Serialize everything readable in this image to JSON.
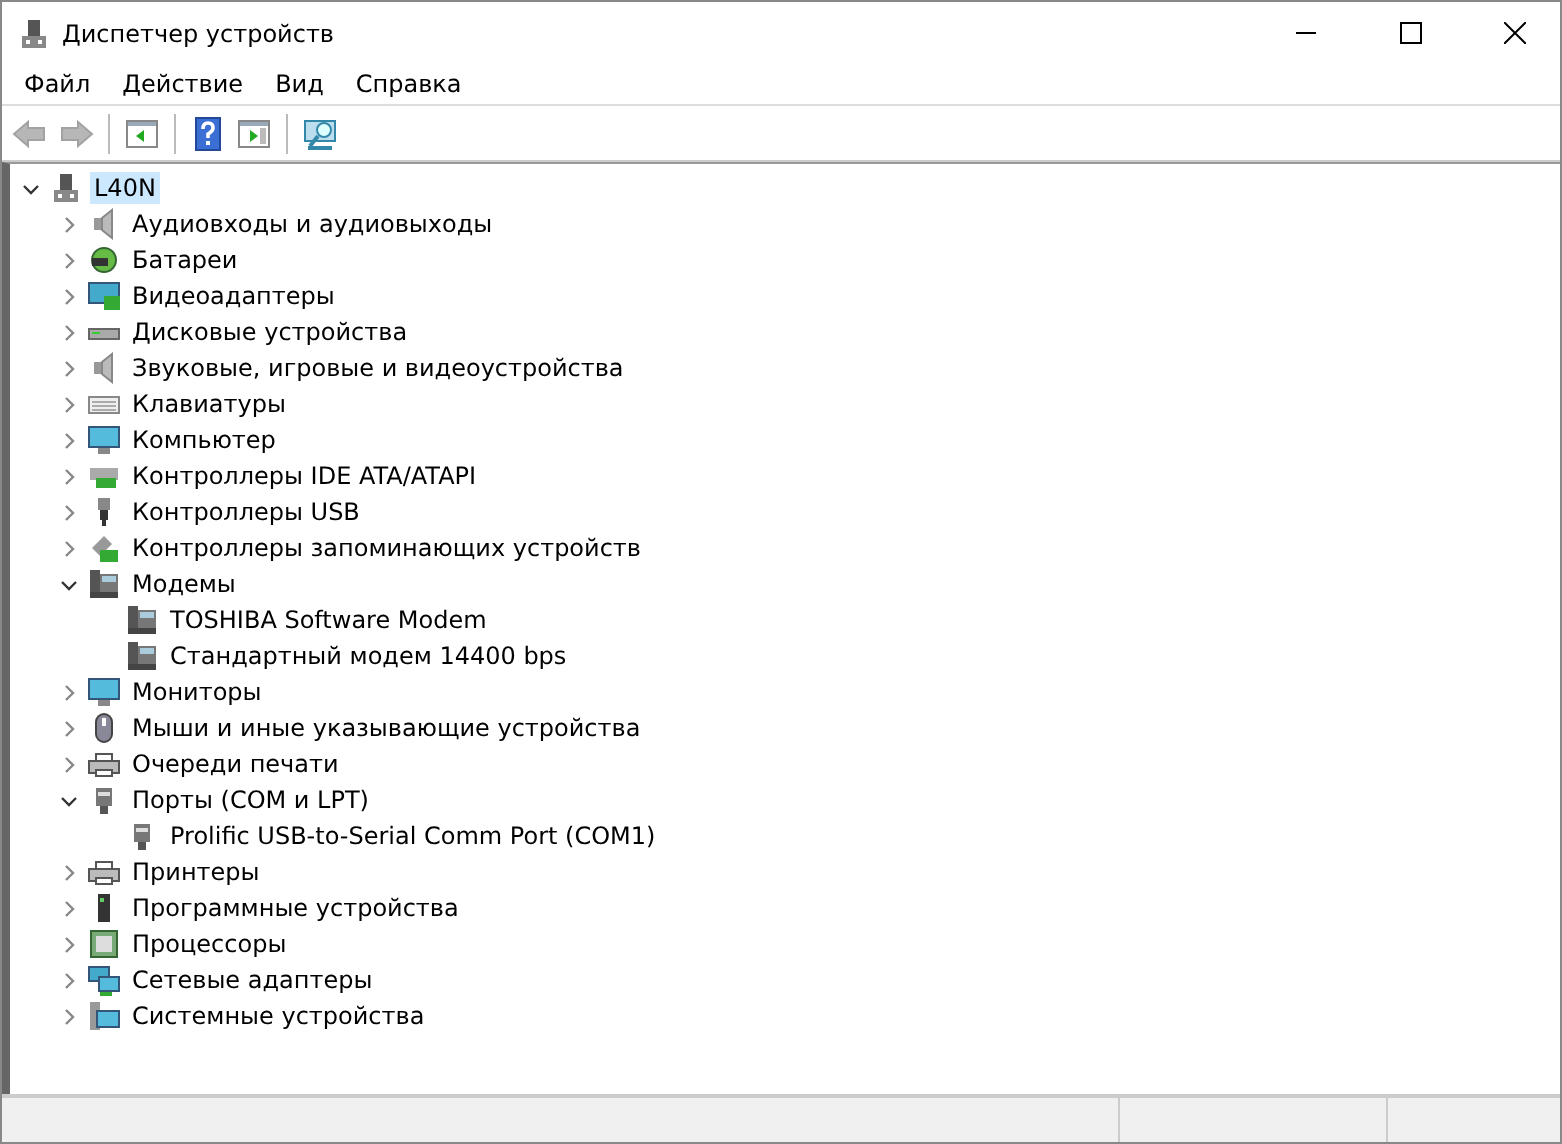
{
  "window": {
    "title": "Диспетчер устройств"
  },
  "menu": [
    {
      "label": "Файл"
    },
    {
      "label": "Действие"
    },
    {
      "label": "Вид"
    },
    {
      "label": "Справка"
    }
  ],
  "toolbar": [
    {
      "kind": "back",
      "disabled": true
    },
    {
      "kind": "forward",
      "disabled": true
    },
    {
      "kind": "separator"
    },
    {
      "kind": "tree-view",
      "disabled": false
    },
    {
      "kind": "separator"
    },
    {
      "kind": "help",
      "disabled": false
    },
    {
      "kind": "panel",
      "disabled": false
    },
    {
      "kind": "separator"
    },
    {
      "kind": "scan",
      "disabled": false
    }
  ],
  "tree": {
    "label": "L40N",
    "kind": "computer",
    "expanded": true,
    "selected": true,
    "children": [
      {
        "label": "Аудиовходы и аудиовыходы",
        "kind": "audio",
        "expanded": false,
        "selected": false
      },
      {
        "label": "Батареи",
        "kind": "battery",
        "expanded": false,
        "selected": false
      },
      {
        "label": "Видеоадаптеры",
        "kind": "display",
        "expanded": false,
        "selected": false
      },
      {
        "label": "Дисковые устройства",
        "kind": "disk",
        "expanded": false,
        "selected": false
      },
      {
        "label": "Звуковые, игровые и видеоустройства",
        "kind": "audio",
        "expanded": false,
        "selected": false
      },
      {
        "label": "Клавиатуры",
        "kind": "keyboard",
        "expanded": false,
        "selected": false
      },
      {
        "label": "Компьютер",
        "kind": "monitor",
        "expanded": false,
        "selected": false
      },
      {
        "label": "Контроллеры IDE ATA/ATAPI",
        "kind": "card",
        "expanded": false,
        "selected": false
      },
      {
        "label": "Контроллеры USB",
        "kind": "usb",
        "expanded": false,
        "selected": false
      },
      {
        "label": "Контроллеры запоминающих устройств",
        "kind": "storage",
        "expanded": false,
        "selected": false
      },
      {
        "label": "Модемы",
        "kind": "modem",
        "expanded": true,
        "selected": false,
        "children": [
          {
            "label": "TOSHIBA Software Modem",
            "kind": "modem",
            "selected": false
          },
          {
            "label": "Стандартный модем 14400 bps",
            "kind": "modem",
            "selected": false
          }
        ]
      },
      {
        "label": "Мониторы",
        "kind": "monitor",
        "expanded": false,
        "selected": false
      },
      {
        "label": "Мыши и иные указывающие устройства",
        "kind": "mouse",
        "expanded": false,
        "selected": false
      },
      {
        "label": "Очереди печати",
        "kind": "printer",
        "expanded": false,
        "selected": false
      },
      {
        "label": "Порты (COM и LPT)",
        "kind": "port",
        "expanded": true,
        "selected": false,
        "children": [
          {
            "label": "Prolific USB-to-Serial Comm Port (COM1)",
            "kind": "port",
            "selected": false
          }
        ]
      },
      {
        "label": "Принтеры",
        "kind": "printer",
        "expanded": false,
        "selected": false
      },
      {
        "label": "Программные устройства",
        "kind": "software",
        "expanded": false,
        "selected": false
      },
      {
        "label": "Процессоры",
        "kind": "cpu",
        "expanded": false,
        "selected": false
      },
      {
        "label": "Сетевые адаптеры",
        "kind": "network",
        "expanded": false,
        "selected": false
      },
      {
        "label": "Системные устройства",
        "kind": "system",
        "expanded": false,
        "selected": false
      }
    ]
  }
}
